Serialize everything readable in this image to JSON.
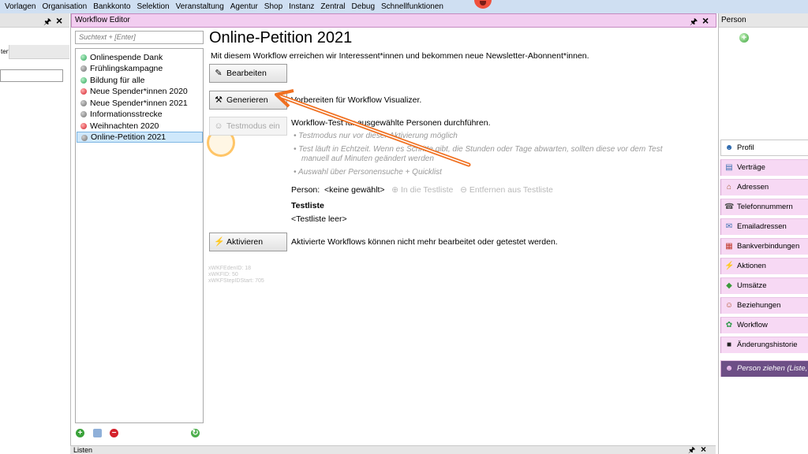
{
  "menu": [
    "Vorlagen",
    "Organisation",
    "Bankkonto",
    "Selektion",
    "Veranstaltung",
    "Agentur",
    "Shop",
    "Instanz",
    "Zentral",
    "Debug",
    "Schnellfunktionen"
  ],
  "left_stub": {
    "tab_label": "tert"
  },
  "editor": {
    "window_title": "Workflow Editor",
    "search_placeholder": "Suchtext + [Enter]",
    "workflows": [
      {
        "label": "Onlinespende Dank",
        "status": "green"
      },
      {
        "label": "Frühlingskampagne",
        "status": "gray"
      },
      {
        "label": "Bildung für alle",
        "status": "green"
      },
      {
        "label": "Neue Spender*innen 2020",
        "status": "red"
      },
      {
        "label": "Neue Spender*innen 2021",
        "status": "gray"
      },
      {
        "label": "Informationsstrecke",
        "status": "gray"
      },
      {
        "label": "Weihnachten 2020",
        "status": "red"
      },
      {
        "label": "Online-Petition 2021",
        "status": "gray",
        "selected": true
      }
    ],
    "detail": {
      "title": "Online-Petition 2021",
      "description": "Mit diesem Workflow erreichen wir Interessent*innen und bekommen neue Newsletter-Abonnent*innen.",
      "edit_button": "Bearbeiten",
      "generate_button": "Generieren",
      "generate_text": "Vorbereiten für Workflow Visualizer.",
      "test_button": "Testmodus ein",
      "test_text": "Workflow-Test für ausgewählte Personen durchführen.",
      "test_notes": [
        "Testmodus nur vor dieser Aktivierung möglich",
        "Test läuft in Echtzeit. Wenn es Schritte gibt, die Stunden oder Tage abwarten, sollten diese vor dem Test",
        "manuell auf Minuten geändert werden",
        "Auswahl über Personensuche + Quicklist"
      ],
      "person_label": "Person:",
      "person_value": "<keine gewählt>",
      "add_to_testlist": "In die Testliste",
      "remove_from_testlist": "Entfernen aus Testliste",
      "testlist_heading": "Testliste",
      "testlist_empty": "<Testliste leer>",
      "activate_button": "Aktivieren",
      "activate_text": "Aktivierte Workflows können nicht mehr bearbeitet oder getestet werden.",
      "meta": [
        "xWKFEdenID: 18",
        "xWKFID: 50",
        "xWKFStepIDStart: 705"
      ]
    }
  },
  "person_panel": {
    "title": "Person",
    "items": [
      {
        "label": "Profil",
        "icon": "person-icon"
      },
      {
        "label": "Verträge",
        "icon": "contract-icon"
      },
      {
        "label": "Adressen",
        "icon": "house-icon"
      },
      {
        "label": "Telefonnummern",
        "icon": "phone-icon"
      },
      {
        "label": "Emailadressen",
        "icon": "mail-icon"
      },
      {
        "label": "Bankverbindungen",
        "icon": "bank-icon"
      },
      {
        "label": "Aktionen",
        "icon": "lightning-icon"
      },
      {
        "label": "Umsätze",
        "icon": "money-icon"
      },
      {
        "label": "Beziehungen",
        "icon": "people-icon"
      },
      {
        "label": "Workflow",
        "icon": "workflow-icon"
      },
      {
        "label": "Änderungshistorie",
        "icon": "history-icon"
      },
      {
        "label": "Person ziehen (Liste, etc.)",
        "icon": "drag-person-icon"
      }
    ]
  },
  "bottom_panel": {
    "title": "Listen"
  }
}
